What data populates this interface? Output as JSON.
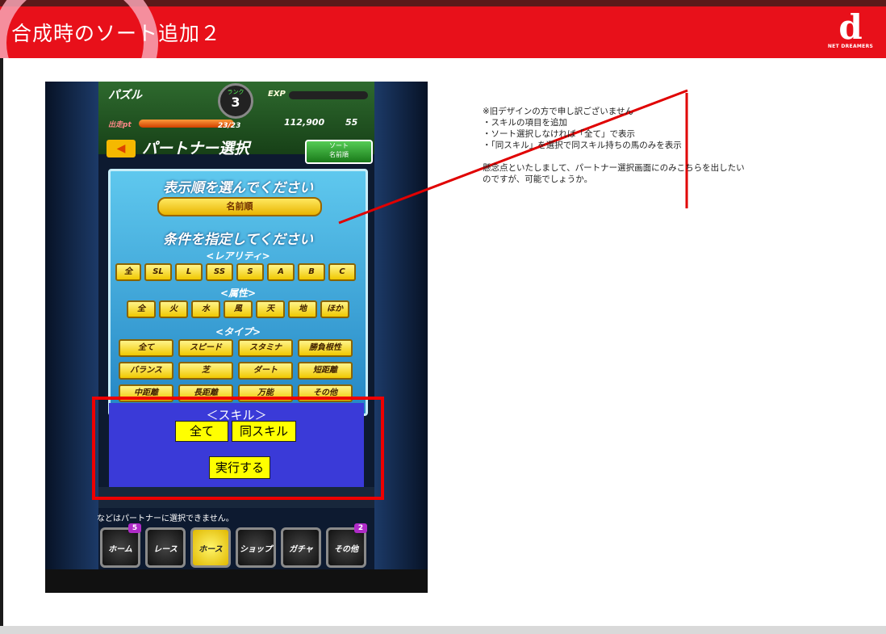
{
  "slide": {
    "title": "合成時のソート追加２",
    "logo_mark": "d",
    "logo_text": "NET DREAMERS"
  },
  "game": {
    "hud": {
      "mode": "パズル",
      "rank_label": "ランク",
      "rank_value": "3",
      "exp_label": "EXP",
      "sortie_label": "出走pt",
      "sortie_value": "23/23",
      "money": "112,900",
      "item_count": "55"
    },
    "screen_title": "パートナー選択",
    "sort_button": {
      "line1": "ソート",
      "line2": "名前順"
    },
    "panel": {
      "order_heading": "表示順を選んでください",
      "order_value": "名前順",
      "cond_heading": "条件を指定してください",
      "rarity_label": "<レアリティ>",
      "rarity": [
        "全",
        "SL",
        "L",
        "SS",
        "S",
        "A",
        "B",
        "C"
      ],
      "attr_label": "<属性>",
      "attributes": [
        "全",
        "火",
        "水",
        "風",
        "天",
        "地",
        "ほか"
      ],
      "type_label": "<タイプ>",
      "types": [
        "全て",
        "スピード",
        "スタミナ",
        "勝負根性",
        "バランス",
        "芝",
        "ダート",
        "短距離",
        "中距離",
        "長距離",
        "万能",
        "その他"
      ]
    },
    "skill": {
      "label": "＜スキル＞",
      "all": "全て",
      "same": "同スキル",
      "execute": "実行する"
    },
    "notice": "などはパートナーに選択できません。",
    "nav": [
      {
        "label": "ホーム",
        "badge": "5"
      },
      {
        "label": "レース",
        "badge": ""
      },
      {
        "label": "ホース",
        "badge": ""
      },
      {
        "label": "ショップ",
        "badge": ""
      },
      {
        "label": "ガチャ",
        "badge": ""
      },
      {
        "label": "その他",
        "badge": "2"
      }
    ]
  },
  "note": {
    "lines": [
      "※旧デザインの方で申し訳ございません",
      "・スキルの項目を追加",
      "・ソート選択しなければ「全て」で表示",
      "・「同スキル」を選択で同スキル持ちの馬のみを表示",
      "",
      "懸念点といたしまして、パートナー選択画面にのみこちらを出したい",
      "のですが、可能でしょうか。"
    ]
  },
  "colors": {
    "header_red": "#e8101a",
    "annotation_red": "#e00000",
    "skill_blue": "#3a3ad8",
    "button_yellow": "#ffff00"
  }
}
